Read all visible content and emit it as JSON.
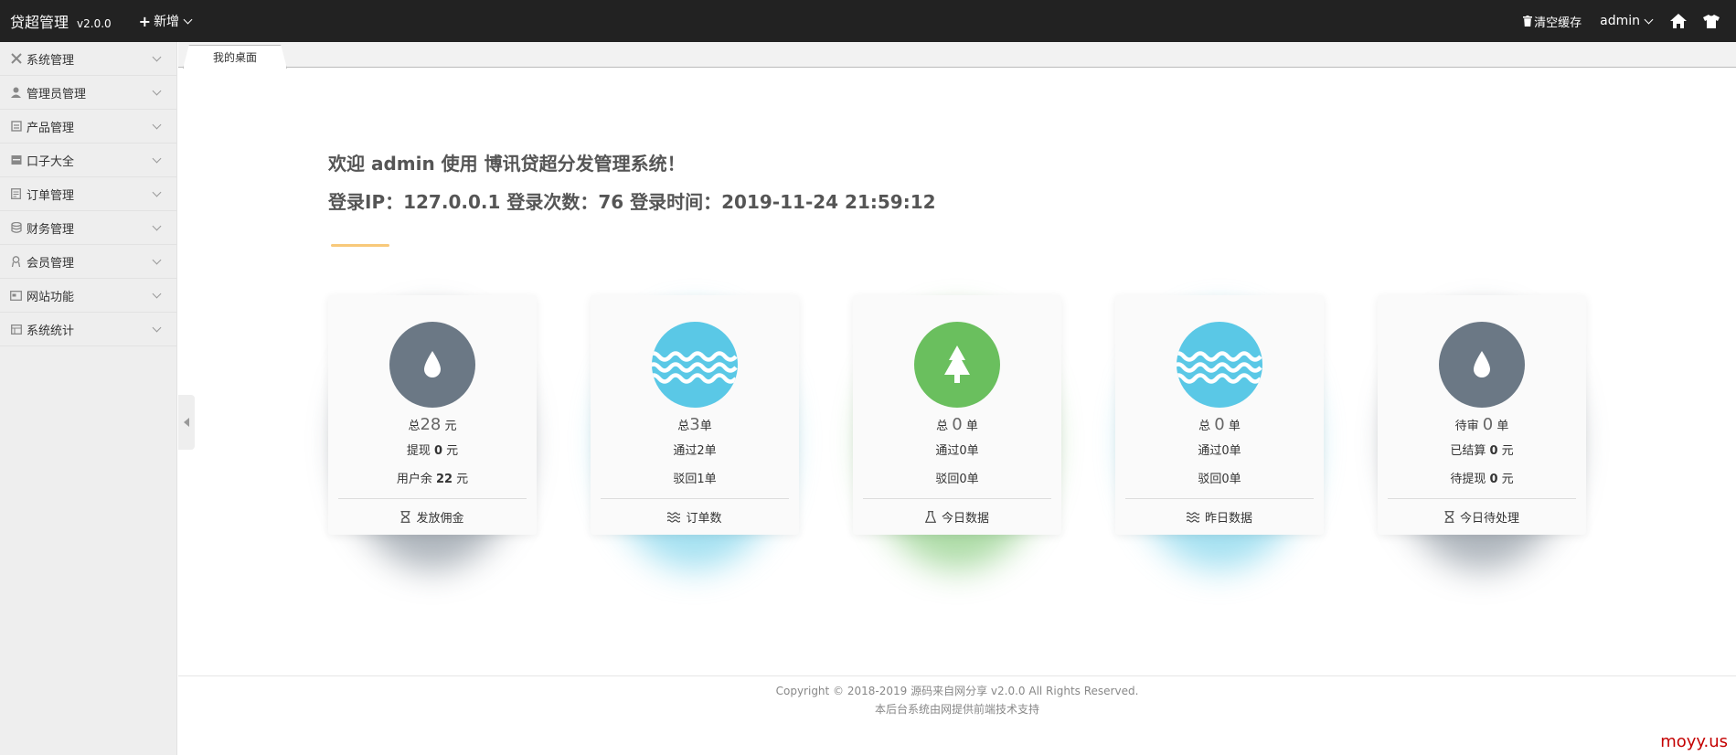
{
  "header": {
    "brand": "贷超管理",
    "version": "v2.0.0",
    "new_label": "新增",
    "clear_cache": "清空缓存",
    "user": "admin"
  },
  "sidebar": {
    "items": [
      {
        "label": "系统管理",
        "icon": "tools-icon"
      },
      {
        "label": "管理员管理",
        "icon": "user-icon"
      },
      {
        "label": "产品管理",
        "icon": "product-icon"
      },
      {
        "label": "口子大全",
        "icon": "storefront-icon"
      },
      {
        "label": "订单管理",
        "icon": "order-icon"
      },
      {
        "label": "财务管理",
        "icon": "database-icon"
      },
      {
        "label": "会员管理",
        "icon": "member-icon"
      },
      {
        "label": "网站功能",
        "icon": "website-icon"
      },
      {
        "label": "系统统计",
        "icon": "stats-icon"
      }
    ]
  },
  "tabs": [
    {
      "label": "我的桌面"
    }
  ],
  "main": {
    "welcome": "欢迎 admin 使用 博讯贷超分发管理系统！",
    "login_info": "登录IP：127.0.0.1 登录次数：76 登录时间：2019-11-24 21:59:12"
  },
  "cards": [
    {
      "color": "#6b7885",
      "icon": "water-drop-icon",
      "l1_pre": "总",
      "l1_num": "28",
      "l1_suf": " 元",
      "l2_pre": "提现 ",
      "l2_num": "0",
      "l2_suf": " 元",
      "l3_pre": "用户余 ",
      "l3_num": "22",
      "l3_suf": " 元",
      "footer": "发放佣金",
      "footer_icon": "hourglass-icon"
    },
    {
      "color": "#5ac8e6",
      "icon": "waves-icon",
      "l1_pre": "总",
      "l1_num": "3",
      "l1_suf": "单",
      "l2_pre": "通过2单",
      "l2_num": "",
      "l2_suf": "",
      "l3_pre": "驳回1单",
      "l3_num": "",
      "l3_suf": "",
      "footer": "订单数",
      "footer_icon": "waves-small-icon"
    },
    {
      "color": "#6abf5e",
      "icon": "tree-icon",
      "l1_pre": "总 ",
      "l1_num": "0",
      "l1_suf": " 单",
      "l2_pre": "通过0单",
      "l2_num": "",
      "l2_suf": "",
      "l3_pre": "驳回0单",
      "l3_num": "",
      "l3_suf": "",
      "footer": "今日数据",
      "footer_icon": "flask-icon"
    },
    {
      "color": "#5ac8e6",
      "icon": "waves-icon",
      "l1_pre": "总 ",
      "l1_num": "0",
      "l1_suf": " 单",
      "l2_pre": "通过0单",
      "l2_num": "",
      "l2_suf": "",
      "l3_pre": "驳回0单",
      "l3_num": "",
      "l3_suf": "",
      "footer": "昨日数据",
      "footer_icon": "waves-small-icon"
    },
    {
      "color": "#6b7885",
      "icon": "water-drop-icon",
      "l1_pre": "待审 ",
      "l1_num": "0",
      "l1_suf": " 单",
      "l2_pre": "已结算 ",
      "l2_num": "0",
      "l2_suf": " 元",
      "l3_pre": "待提现 ",
      "l3_num": "0",
      "l3_suf": " 元",
      "footer": "今日待处理",
      "footer_icon": "hourglass-icon"
    }
  ],
  "footer": {
    "copyright": "Copyright © 2018-2019 源码来自网分享 v2.0.0 All Rights Reserved.",
    "support": "本后台系统由网提供前端技术支持"
  },
  "watermark": "moyy.us"
}
